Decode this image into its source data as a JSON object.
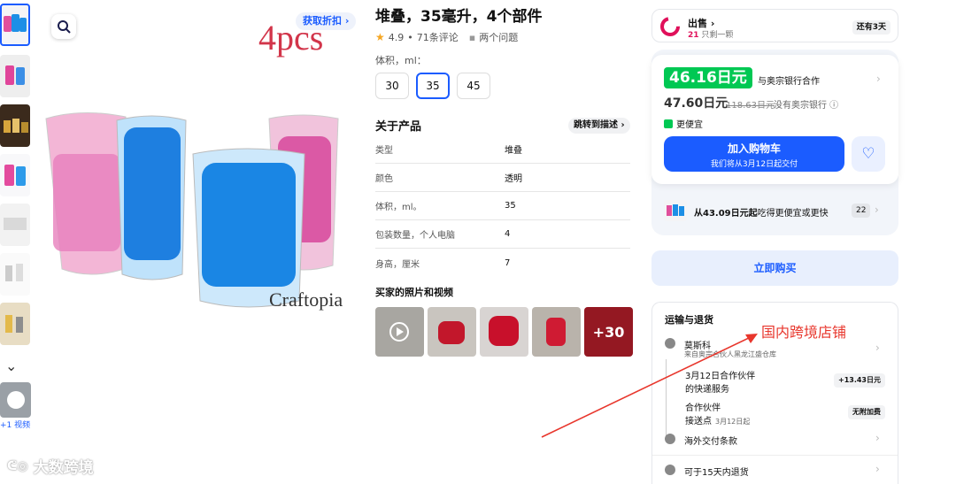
{
  "gallery": {
    "video_label": "+1 视频",
    "image_text_count": "4pcs",
    "image_text_brand": "Craftopia",
    "discount_label": "获取折扣"
  },
  "product": {
    "title": "堆叠，35毫升，4个部件",
    "rating": "4.9",
    "reviews": "71条评论",
    "questions": "两个问题",
    "volume_label": "体积，ml：",
    "volume_options": [
      "30",
      "35",
      "45"
    ],
    "volume_selected": "35"
  },
  "about": {
    "title": "关于产品",
    "jump_label": "跳转到描述",
    "specs": [
      {
        "k": "类型",
        "v": "堆叠"
      },
      {
        "k": "颜色",
        "v": "透明"
      },
      {
        "k": "体积，ml。",
        "v": "35"
      },
      {
        "k": "包装数量，个人电脑",
        "v": "4"
      },
      {
        "k": "身高，厘米",
        "v": "7"
      }
    ]
  },
  "photos": {
    "title": "买家的照片和视频",
    "more": "+30"
  },
  "seller": {
    "label": "出售",
    "sub_count": "21",
    "sub_text": "只剩一颗",
    "days": "还有3天"
  },
  "price": {
    "bank_price": "46.16日元",
    "bank_partner": "与奥宗银行合作",
    "regular_price": "47.60日元",
    "old_price": "118.63日元",
    "no_bank": "没有奥宗银行",
    "cheaper": "更便宜",
    "cart_label": "加入购物车",
    "cart_sub": "我们将从3月12日起交付"
  },
  "cheaper_offer": {
    "bold": "从43.09日元起",
    "rest": "吃得更便宜或更快",
    "count": "22"
  },
  "buy_now": "立即购买",
  "shipping": {
    "title": "运输与退货",
    "pickup_title": "莫斯科",
    "pickup_sub": "来自奥宗合伙人黑龙江盛仓库",
    "partner1_l1": "3月12日合作伙伴",
    "partner1_l2": "的快递服务",
    "partner1_price": "+13.43日元",
    "partner2_l1": "合作伙伴",
    "partner2_l2": "接送点",
    "partner2_date": "3月12日起",
    "partner2_tag": "无附加费",
    "overseas": "海外交付条款",
    "returns": "可于15天内退货"
  },
  "annotation": {
    "text": "国内跨境店铺",
    "watermark": "大数跨境"
  },
  "colors": {
    "accent": "#1b5cff",
    "green": "#00c853",
    "pink": "#e0105a",
    "annotation": "#e8362c"
  }
}
